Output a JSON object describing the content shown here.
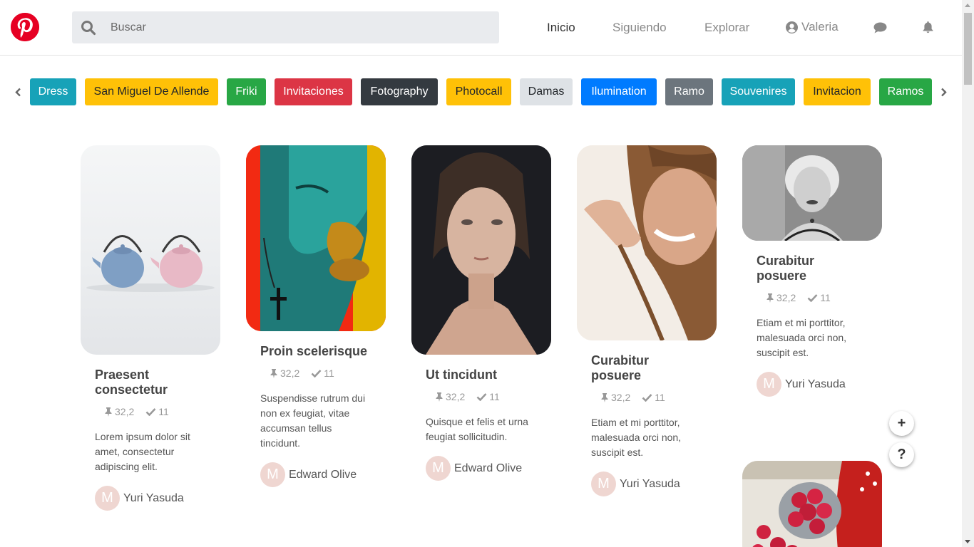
{
  "search": {
    "placeholder": "Buscar"
  },
  "nav": {
    "home": "Inicio",
    "following": "Siguiendo",
    "explore": "Explorar",
    "user": "Valeria"
  },
  "tags": [
    {
      "label": "Dress",
      "bg": "#17a2b8",
      "fg": "#ffffff"
    },
    {
      "label": "San Miguel De Allende",
      "bg": "#ffc107",
      "fg": "#212529"
    },
    {
      "label": "Friki",
      "bg": "#28a745",
      "fg": "#ffffff"
    },
    {
      "label": "Invitaciones",
      "bg": "#dc3545",
      "fg": "#ffffff"
    },
    {
      "label": "Fotography",
      "bg": "#343a40",
      "fg": "#ffffff"
    },
    {
      "label": "Photocall",
      "bg": "#ffc107",
      "fg": "#212529"
    },
    {
      "label": "Damas",
      "bg": "#dee2e6",
      "fg": "#212529"
    },
    {
      "label": "Ilumination",
      "bg": "#007bff",
      "fg": "#ffffff"
    },
    {
      "label": "Ramo",
      "bg": "#6c757d",
      "fg": "#ffffff"
    },
    {
      "label": "Souvenires",
      "bg": "#17a2b8",
      "fg": "#ffffff"
    },
    {
      "label": "Invitacion",
      "bg": "#ffc107",
      "fg": "#212529"
    },
    {
      "label": "Ramos",
      "bg": "#28a745",
      "fg": "#ffffff"
    }
  ],
  "cards": [
    {
      "title": "Praesent consectetur",
      "pins": "32,2",
      "checks": "11",
      "desc": "Lorem ipsum dolor sit amet, consectetur adipiscing elit.",
      "avatar": "M",
      "author": "Yuri Yasuda"
    },
    {
      "title": "Proin scelerisque",
      "pins": "32,2",
      "checks": "11",
      "desc": "Suspendisse rutrum dui non ex feugiat, vitae accumsan tellus tincidunt.",
      "avatar": "M",
      "author": "Edward Olive"
    },
    {
      "title": "Ut tincidunt",
      "pins": "32,2",
      "checks": "11",
      "desc": "Quisque et felis et urna feugiat sollicitudin.",
      "avatar": "M",
      "author": "Edward Olive"
    },
    {
      "title": "Curabitur posuere",
      "pins": "32,2",
      "checks": "11",
      "desc": "Etiam et mi porttitor, malesuada orci non, suscipit est.",
      "avatar": "M",
      "author": "Yuri Yasuda"
    },
    {
      "title": "Curabitur posuere",
      "pins": "32,2",
      "checks": "11",
      "desc": "Etiam et mi porttitor, malesuada orci non, suscipit est.",
      "avatar": "M",
      "author": "Yuri Yasuda"
    }
  ],
  "fab": {
    "add": "+",
    "help": "?"
  },
  "colors": {
    "brand": "#e60023",
    "search_bg": "#e9ebee",
    "avatar_bg": "#efd6d1"
  }
}
